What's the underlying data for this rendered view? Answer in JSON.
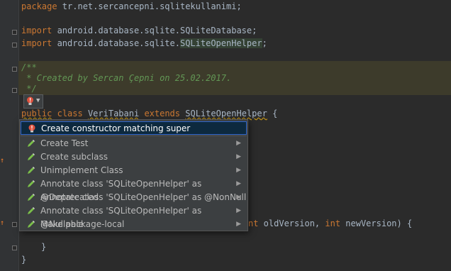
{
  "editor": {
    "line_package": {
      "kw": "package",
      "rest": " tr.net.sercancepni.sqlitekullanimi;"
    },
    "line_import1": {
      "kw": "import",
      "rest": " android.database.sqlite.",
      "cls": "SQLiteDatabase",
      "end": ";"
    },
    "line_import2": {
      "kw": "import",
      "rest": " android.database.sqlite.",
      "cls": "SQLiteOpenHelper",
      "end": ";"
    },
    "comment_open": "/**",
    "comment_body": " * Created by Sercan Çepni on 25.02.2017.",
    "comment_close": " */",
    "class_line": {
      "kw_public": "public",
      "kw_class": "class",
      "name": "VeriTabani",
      "kw_extends": "extends",
      "super": "SQLiteOpenHelper",
      "brace": "{"
    },
    "method_frag": {
      "pre": "nt",
      "mid": " oldVersion, ",
      "kw": "int",
      "post": " newVersion) {"
    },
    "close_brace_inner": "}",
    "close_brace_outer": "}"
  },
  "intention_bulb": {
    "icon": "bulb-error-icon"
  },
  "popup": {
    "items": [
      {
        "label": "Create constructor matching super",
        "icon": "bulb-error-icon",
        "submenu": false,
        "selected": true
      },
      {
        "label": "Create Test",
        "icon": "pencil-icon",
        "submenu": true
      },
      {
        "label": "Create subclass",
        "icon": "pencil-icon",
        "submenu": true
      },
      {
        "label": "Unimplement Class",
        "icon": "pencil-icon",
        "submenu": true
      },
      {
        "label": "Annotate class 'SQLiteOpenHelper' as @Deprecated",
        "icon": "pencil-icon",
        "submenu": true
      },
      {
        "label": "Annotate class 'SQLiteOpenHelper' as @NonNull",
        "icon": "pencil-icon",
        "submenu": true
      },
      {
        "label": "Annotate class 'SQLiteOpenHelper' as @Nullable",
        "icon": "pencil-icon",
        "submenu": true
      },
      {
        "label": "Make package-local",
        "icon": "pencil-icon",
        "submenu": true
      }
    ]
  },
  "colors": {
    "editor_bg": "#2b2b2b",
    "keyword": "#cc7832",
    "comment": "#629755",
    "selection": "#0d293e",
    "popup_bg": "#3c3f41"
  }
}
